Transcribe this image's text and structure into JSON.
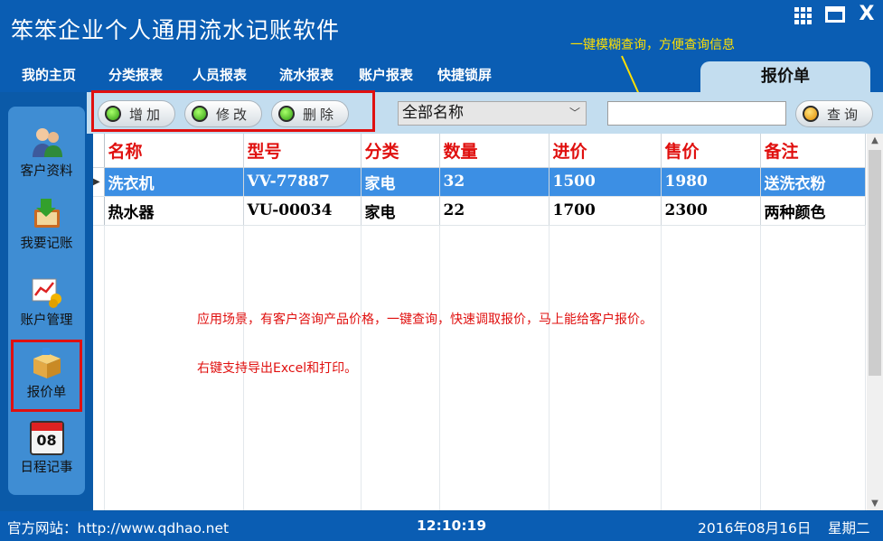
{
  "app": {
    "title": "笨笨企业个人通用流水记账软件"
  },
  "hints": {
    "search_tip": "一键模糊查询，方便查询信息",
    "scenario": "应用场景，有客户咨询产品价格，一键查询，快速调取报价，马上能给客户报价。",
    "export": "右键支持导出Excel和打印。"
  },
  "menu": [
    "我的主页",
    "分类报表",
    "人员报表",
    "流水报表",
    "账户报表",
    "快捷锁屏"
  ],
  "active_tab": "报价单",
  "toolbar": {
    "add": "增加",
    "edit": "修改",
    "delete": "删除",
    "filter_value": "全部名称",
    "search_value": "",
    "query": "查询"
  },
  "sidebar": [
    {
      "label": "客户资料",
      "icon": "customers-icon"
    },
    {
      "label": "我要记账",
      "icon": "bookkeeping-icon"
    },
    {
      "label": "账户管理",
      "icon": "account-chart-icon"
    },
    {
      "label": "报价单",
      "icon": "quote-box-icon"
    },
    {
      "label": "日程记事",
      "icon": "calendar-icon",
      "date": "08"
    }
  ],
  "table": {
    "columns": [
      "名称",
      "型号",
      "分类",
      "数量",
      "进价",
      "售价",
      "备注"
    ],
    "rows": [
      [
        "洗衣机",
        "VV-77887",
        "家电",
        "32",
        "1500",
        "1980",
        "送洗衣粉"
      ],
      [
        "热水器",
        "VU-00034",
        "家电",
        "22",
        "1700",
        "2300",
        "两种颜色"
      ]
    ]
  },
  "status": {
    "website": "官方网站：http://www.qdhao.net",
    "time": "12:10:19",
    "date": "2016年08月16日",
    "weekday": "星期二"
  },
  "colors": {
    "header_blue": "#0a5db3",
    "panel": "#c3ddef",
    "highlight": "#e01010",
    "selected_row": "#3c8fe4",
    "hint": "#ffe000"
  }
}
